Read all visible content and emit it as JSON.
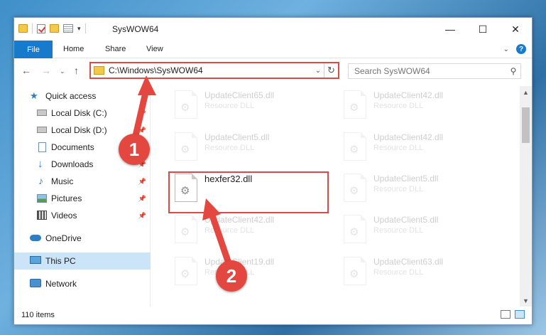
{
  "window": {
    "title": "SysWOW64",
    "minimize_icon": "minimize-icon",
    "maximize_icon": "maximize-icon",
    "close_icon": "close-icon"
  },
  "ribbon": {
    "tabs": [
      {
        "label": "File",
        "active": true
      },
      {
        "label": "Home"
      },
      {
        "label": "Share"
      },
      {
        "label": "View"
      }
    ]
  },
  "navigation": {
    "address": "C:\\Windows\\SysWOW64",
    "search_placeholder": "Search SysWOW64"
  },
  "sidebar": {
    "items": [
      {
        "label": "Quick access",
        "icon": "star-icon"
      },
      {
        "label": "Local Disk (C:)",
        "icon": "drive-icon",
        "pinned": true
      },
      {
        "label": "Local Disk (D:)",
        "icon": "drive-icon",
        "pinned": true
      },
      {
        "label": "Documents",
        "icon": "document-icon",
        "pinned": true
      },
      {
        "label": "Downloads",
        "icon": "download-icon",
        "pinned": true
      },
      {
        "label": "Music",
        "icon": "music-icon",
        "pinned": true
      },
      {
        "label": "Pictures",
        "icon": "picture-icon",
        "pinned": true
      },
      {
        "label": "Videos",
        "icon": "video-icon",
        "pinned": true
      },
      {
        "label": "OneDrive",
        "icon": "cloud-icon"
      },
      {
        "label": "This PC",
        "icon": "computer-icon",
        "selected": true
      },
      {
        "label": "Network",
        "icon": "network-icon"
      }
    ]
  },
  "files": [
    {
      "name": "UpdateClient65.dll",
      "type": "Resource DLL"
    },
    {
      "name": "UpdateClient42.dll",
      "type": "Resource DLL"
    },
    {
      "name": "UpdateClient5.dll",
      "type": "Resource DLL"
    },
    {
      "name": "UpdateClient42.dll",
      "type": "Resource DLL"
    },
    {
      "name": "hexfer32.dll",
      "type": ""
    },
    {
      "name": "UpdateClient5.dll",
      "type": "Resource DLL"
    },
    {
      "name": "UpdateClient42.dll",
      "type": "Resource DLL"
    },
    {
      "name": "UpdateClient5.dll",
      "type": "Resource DLL"
    },
    {
      "name": "UpdateClient19.dll",
      "type": "Resource DLL"
    },
    {
      "name": "UpdateClient63.dll",
      "type": "Resource DLL"
    }
  ],
  "status": {
    "item_count": "110 items"
  },
  "annotations": {
    "marker_1": "1",
    "marker_2": "2",
    "color": "#e4473f"
  },
  "colors": {
    "accent": "#1979ca",
    "highlight_border": "#d94a4a",
    "selection": "#cce4f7"
  }
}
